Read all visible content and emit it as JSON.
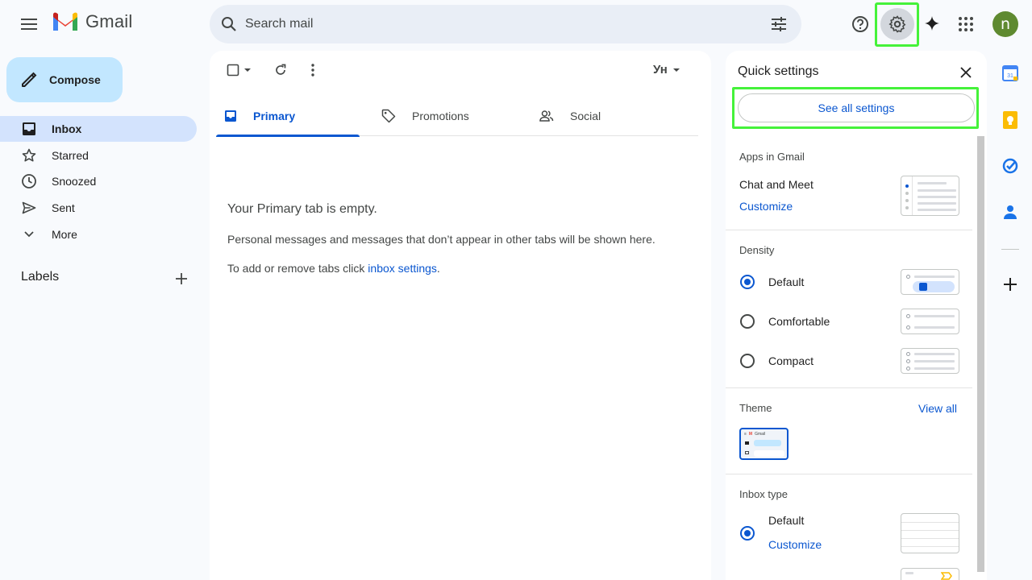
{
  "header": {
    "logo_text": "Gmail",
    "search_placeholder": "Search mail",
    "avatar_letter": "n"
  },
  "nav": {
    "compose_label": "Compose",
    "items": [
      {
        "label": "Inbox",
        "icon": "inbox-icon",
        "active": true
      },
      {
        "label": "Starred",
        "icon": "star-icon"
      },
      {
        "label": "Snoozed",
        "icon": "clock-icon"
      },
      {
        "label": "Sent",
        "icon": "send-icon"
      },
      {
        "label": "More",
        "icon": "chevron-down-icon"
      }
    ],
    "labels_title": "Labels"
  },
  "main": {
    "input_tool_label": "Ун",
    "tabs": [
      {
        "label": "Primary",
        "icon": "inbox-tab-icon",
        "active": true
      },
      {
        "label": "Promotions",
        "icon": "tag-icon"
      },
      {
        "label": "Social",
        "icon": "people-icon"
      }
    ],
    "empty_title": "Your Primary tab is empty.",
    "empty_line1": "Personal messages and messages that don’t appear in other tabs will be shown here.",
    "empty_line2_prefix": "To add or remove tabs click ",
    "empty_line2_link": "inbox settings",
    "empty_line2_suffix": "."
  },
  "quick_settings": {
    "title": "Quick settings",
    "see_all": "See all settings",
    "apps_title": "Apps in Gmail",
    "chat_meet": "Chat and Meet",
    "customize": "Customize",
    "density_title": "Density",
    "density_options": [
      {
        "label": "Default",
        "checked": true
      },
      {
        "label": "Comfortable",
        "checked": false
      },
      {
        "label": "Compact",
        "checked": false
      }
    ],
    "theme_title": "Theme",
    "view_all": "View all",
    "theme_thumb_text": "Gmail",
    "inbox_type_title": "Inbox type",
    "inbox_default": "Default",
    "inbox_customize": "Customize"
  },
  "colors": {
    "accent": "#0b57d0",
    "compose_bg": "#c2e7ff",
    "active_nav": "#d3e3fd",
    "highlight": "#45f23a"
  },
  "right_rail": {
    "calendar_day": "31"
  }
}
